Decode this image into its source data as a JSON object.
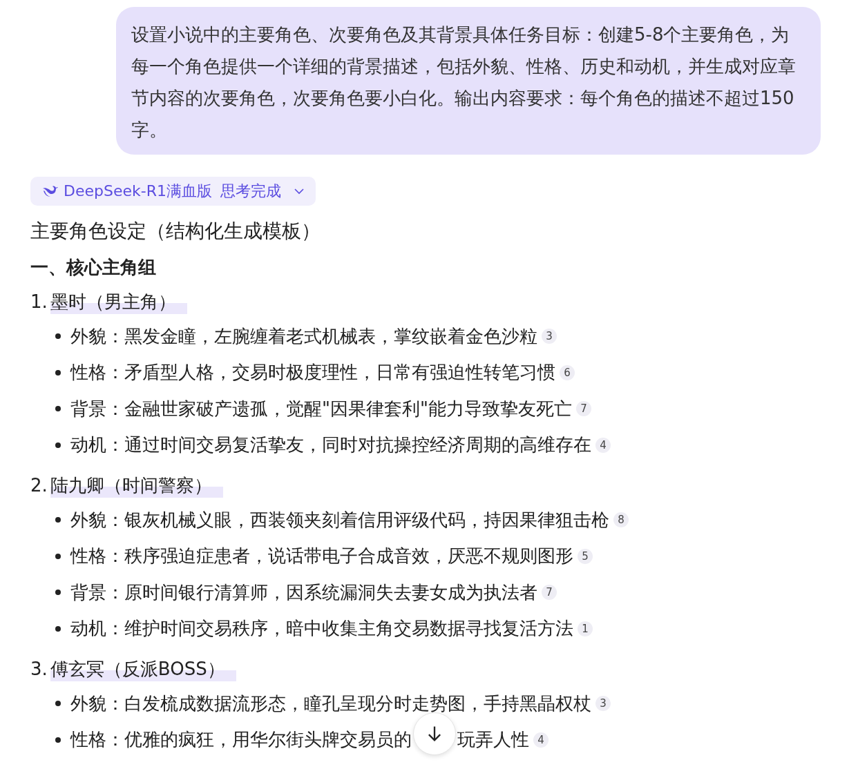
{
  "user_message": "设置小说中的主要角色、次要角色及其背景具体任务目标：创建5-8个主要角色，为每一个角色提供一个详细的背景描述，包括外貌、性格、历史和动机，并生成对应章节内容的次要角色，次要角色要小白化。输出内容要求：每个角色的描述不超过150字。",
  "model_tag": {
    "model": "DeepSeek-R1满血版",
    "status": "思考完成",
    "expanded": false
  },
  "answer_title": "主要角色设定（结构化生成模板）",
  "section_heading": "一、核心主角组",
  "characters": [
    {
      "number": "1.",
      "name": "墨时（男主角）",
      "traits": [
        {
          "label": "外貌：",
          "text": "黑发金瞳，左腕缠着老式机械表，掌纹嵌着金色沙粒",
          "citation": "3"
        },
        {
          "label": "性格：",
          "text": "矛盾型人格，交易时极度理性，日常有强迫性转笔习惯",
          "citation": "6"
        },
        {
          "label": "背景：",
          "text": "金融世家破产遗孤，觉醒\"因果律套利\"能力导致挚友死亡",
          "citation": "7"
        },
        {
          "label": "动机：",
          "text": "通过时间交易复活挚友，同时对抗操控经济周期的高维存在",
          "citation": "4"
        }
      ]
    },
    {
      "number": "2.",
      "name": "陆九卿（时间警察）",
      "traits": [
        {
          "label": "外貌：",
          "text": "银灰机械义眼，西装领夹刻着信用评级代码，持因果律狙击枪",
          "citation": "8"
        },
        {
          "label": "性格：",
          "text": "秩序强迫症患者，说话带电子合成音效，厌恶不规则图形",
          "citation": "5"
        },
        {
          "label": "背景：",
          "text": "原时间银行清算师，因系统漏洞失去妻女成为执法者",
          "citation": "7"
        },
        {
          "label": "动机：",
          "text": "维护时间交易秩序，暗中收集主角交易数据寻找复活方法",
          "citation": "1"
        }
      ]
    },
    {
      "number": "3.",
      "name": "傅玄冥（反派BOSS）",
      "traits": [
        {
          "label": "外貌：",
          "text": "白发梳成数据流形态，瞳孔呈现分时走势图，手持黑晶权杖",
          "citation": "3"
        },
        {
          "label": "性格：",
          "text": "优雅的疯狂，用华尔街头牌交易员的",
          "text_after_cover": "玩弄人性",
          "citation": "4"
        }
      ]
    }
  ]
}
